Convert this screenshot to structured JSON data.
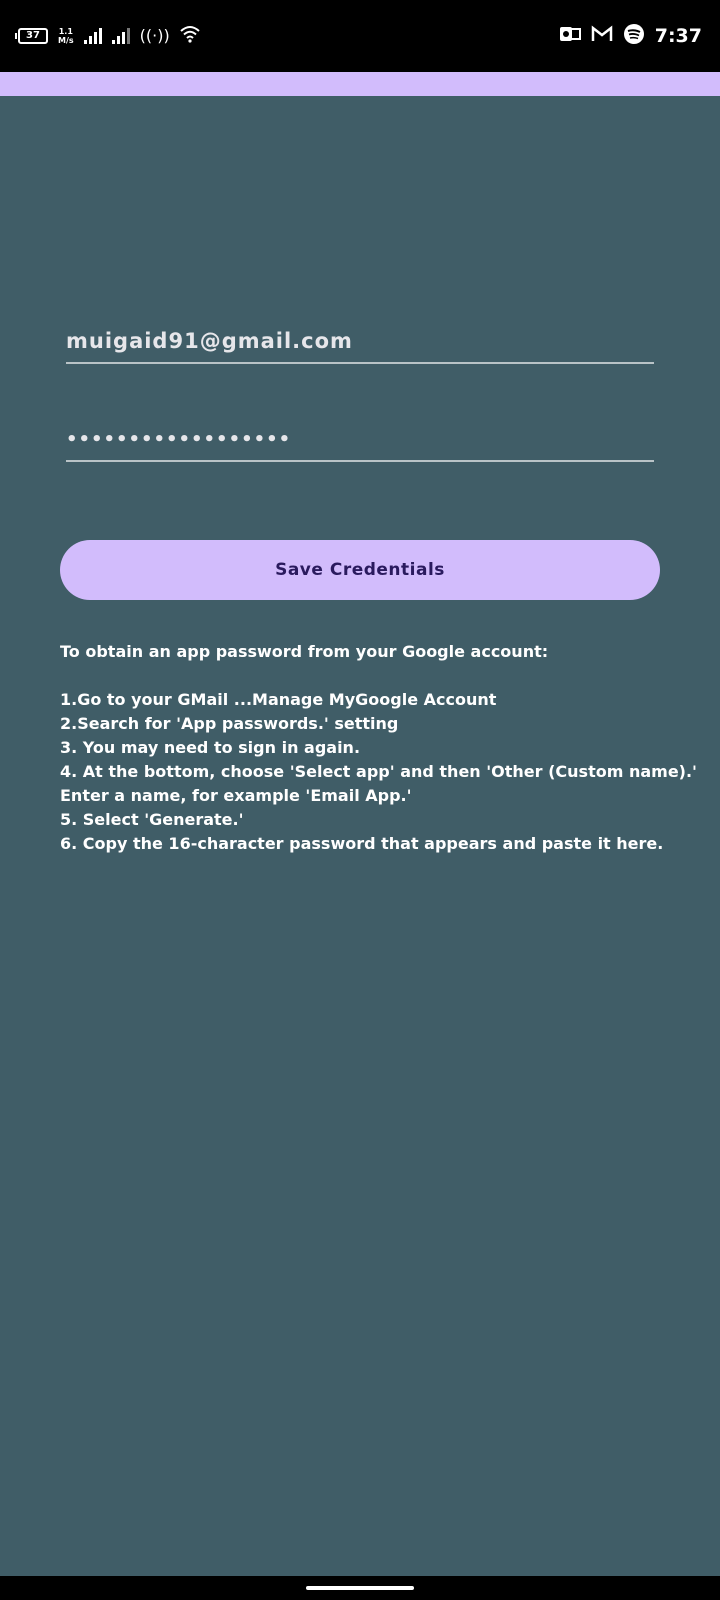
{
  "status_bar": {
    "battery": "37",
    "net_speed_value": "1.1",
    "net_speed_unit": "M/s",
    "time": "7:37"
  },
  "form": {
    "email_value": "muigaid91@gmail.com",
    "password_value": "••••••••••••••••••",
    "save_label": "Save Credentials"
  },
  "instructions": {
    "heading": "To obtain an app password from your Google account:",
    "steps": [
      "1.Go to your GMail ...Manage MyGoogle Account",
      "2.Search for 'App passwords.' setting",
      "3. You may need to sign in again.",
      "4. At the bottom, choose 'Select app' and then 'Other (Custom name).'",
      "Enter a name, for example 'Email App.'",
      "5. Select 'Generate.'",
      "6. Copy the 16-character password that appears and paste it here."
    ]
  },
  "colors": {
    "background": "#405d67",
    "accent": "#d2bcfc",
    "button_text": "#2a1a5e"
  }
}
